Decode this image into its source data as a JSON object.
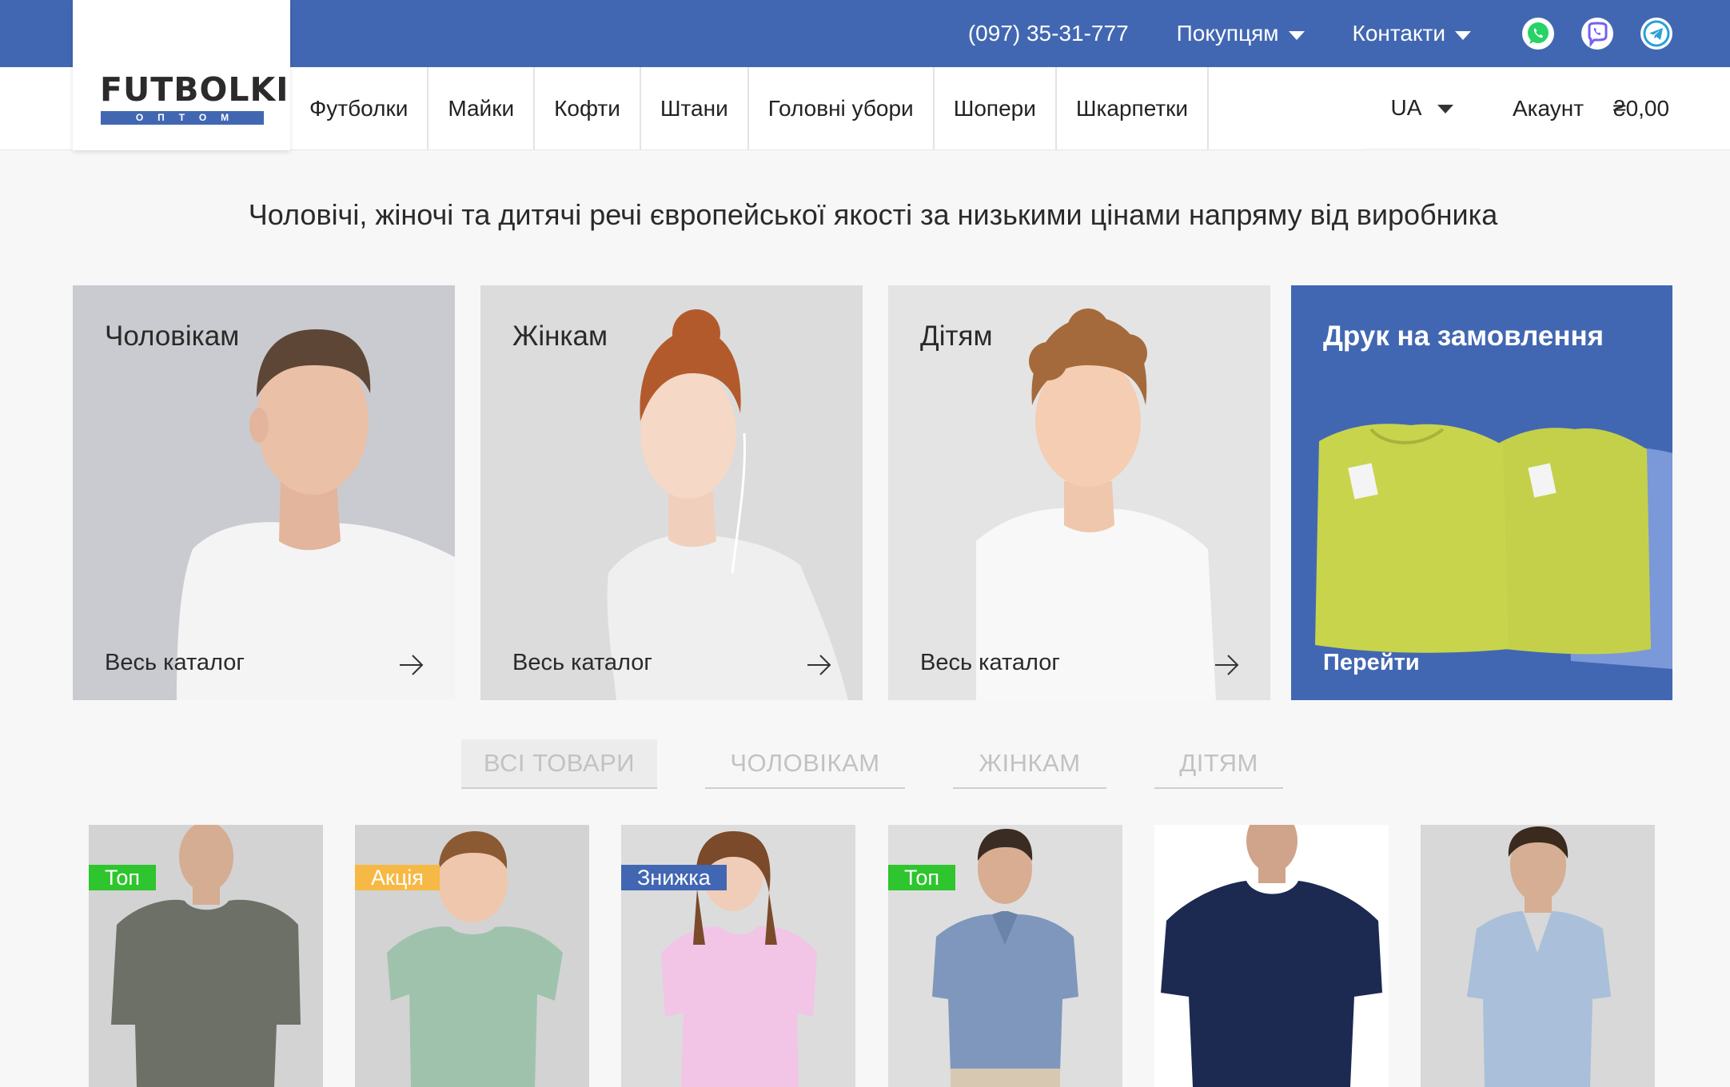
{
  "topbar": {
    "phone": "(097) 35-31-777",
    "buyers_menu": "Покупцям",
    "contacts_menu": "Контакти",
    "social": [
      "whatsapp-icon",
      "viber-icon",
      "telegram-icon"
    ],
    "bg_color": "#4267b2"
  },
  "logo": {
    "title": "FUTBOLKI",
    "subtitle": "ОПТОМ"
  },
  "nav": {
    "categories": [
      "Футболки",
      "Майки",
      "Кофти",
      "Штани",
      "Головні убори",
      "Шопери",
      "Шкарпетки"
    ],
    "language": "UA",
    "account": "Акаунт",
    "cart_total": "₴0,00"
  },
  "headline": "Чоловічі, жіночі та дитячі речі європейської якості за низькими цінами напряму від виробника",
  "cards": [
    {
      "title": "Чоловікам",
      "link": "Весь каталог"
    },
    {
      "title": "Жінкам",
      "link": "Весь каталог"
    },
    {
      "title": "Дітям",
      "link": "Весь каталог"
    },
    {
      "title": "Друк на замовлення",
      "link": "Перейти"
    }
  ],
  "filter_tabs": [
    "ВСІ ТОВАРИ",
    "ЧОЛОВІКАМ",
    "ЖІНКАМ",
    "ДІТЯМ"
  ],
  "filter_active": "ВСІ ТОВАРИ",
  "products": [
    {
      "badge": "Топ",
      "badge_color": "#2ec52e",
      "shirt_color": "#6c7066"
    },
    {
      "badge": "Акція",
      "badge_color": "#f6b945",
      "shirt_color": "#9fc2ad"
    },
    {
      "badge": "Знижка",
      "badge_color": "#4267b2",
      "shirt_color": "#f2c4e6"
    },
    {
      "badge": "Топ",
      "badge_color": "#2ec52e",
      "shirt_color": "#7f97bd"
    },
    {
      "badge": "",
      "badge_color": "",
      "shirt_color": "#1c2a52"
    },
    {
      "badge": "",
      "badge_color": "",
      "shirt_color": "#aabfd9"
    }
  ]
}
